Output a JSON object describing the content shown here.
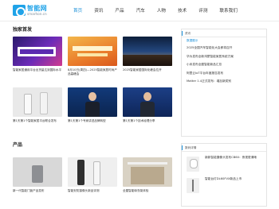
{
  "site": {
    "logo_cn": "智能网",
    "logo_en": "smarhon.cn"
  },
  "nav": {
    "items": [
      {
        "label": "首页",
        "active": true
      },
      {
        "label": "资讯",
        "active": false
      },
      {
        "label": "产品",
        "active": false
      },
      {
        "label": "汽车",
        "active": false
      },
      {
        "label": "人物",
        "active": false
      },
      {
        "label": "技术",
        "active": false
      },
      {
        "label": "评测",
        "active": false
      },
      {
        "label": "联系我们",
        "active": false
      }
    ]
  },
  "sections": {
    "headlines": "独家首发",
    "products": "产品"
  },
  "headline_cards": [
    {
      "caption": "智能家居通用平台出货量达到国际水平"
    },
    {
      "caption": "8月10日(周四)—2025智能家居时尚产品高峰会"
    },
    {
      "caption": "2025智能家居国际化峰会拉开"
    },
    {
      "caption": "第1天第1个智能家居平台联合发布"
    },
    {
      "caption": "第1天第1个专家讲述品牌转型"
    },
    {
      "caption": "第1天第1个技术经理分享"
    }
  ],
  "product_cards": [
    {
      "caption": "新一代智能门锁产品发布"
    },
    {
      "caption": "智能安防摄像头新品评测"
    },
    {
      "caption": "全屋智能晾衣架体验"
    }
  ],
  "sidebar": {
    "news_header": "资讯",
    "news_title": "数据展示",
    "news": [
      "2025全国汽车智能化大会即将召开",
      "华为发布全新鸿蒙智能家居系统方案",
      "小米发布全屋智能新品汇总",
      "阿里云IoT平台年度报告发布",
      "Matter 1.4正式发布：增加新类别"
    ],
    "products_header": "数码详情",
    "products": [
      "新款智能摄像头发布CB60：夜视更清晰",
      "智能台灯DL60FVX新品上市"
    ]
  },
  "colors": {
    "accent": "#1a8fd8",
    "logo": "#20a3e8"
  }
}
